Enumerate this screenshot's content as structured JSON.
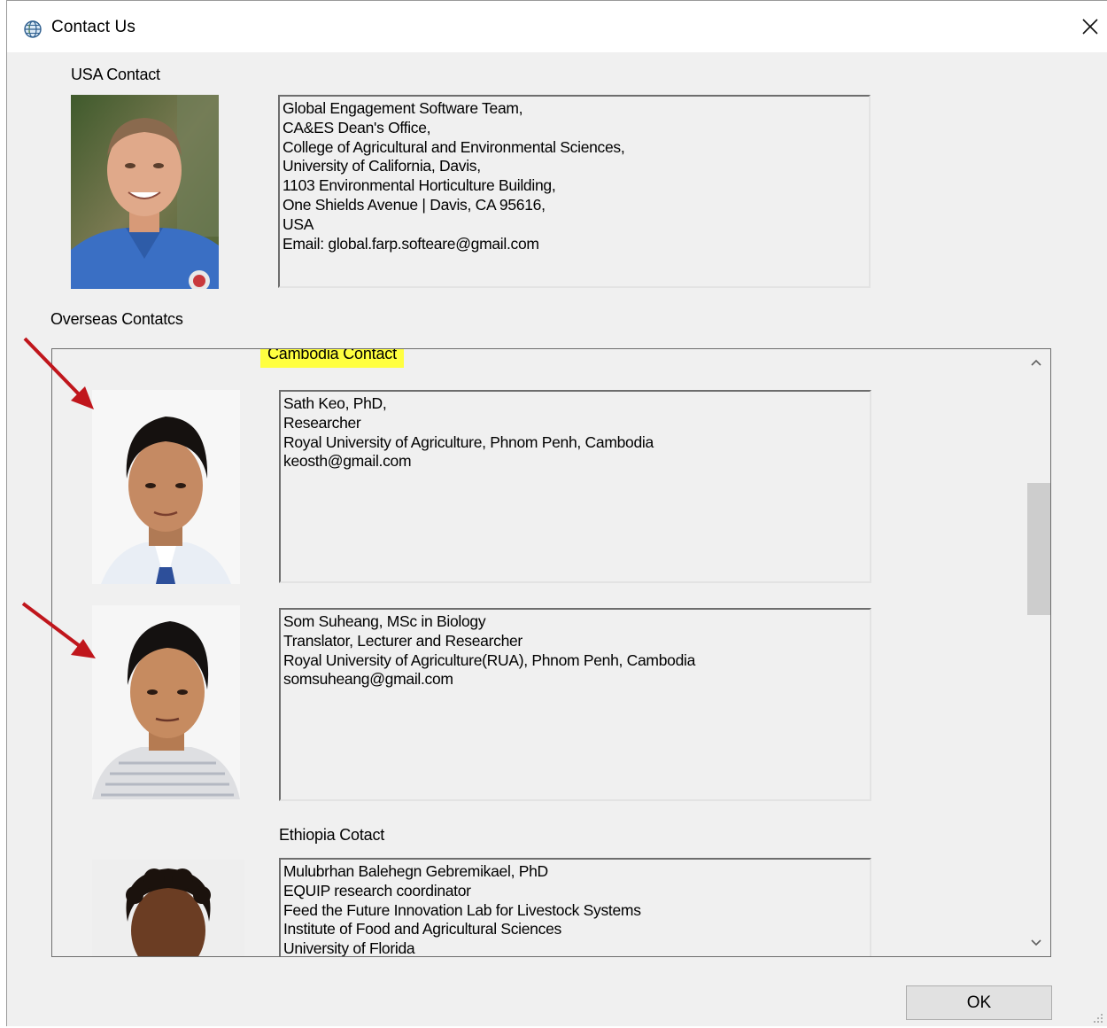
{
  "window": {
    "title": "Contact Us",
    "ok_label": "OK"
  },
  "usa": {
    "label": "USA Contact",
    "lines": [
      "Global Engagement Software Team,",
      "CA&ES Dean's Office,",
      "College of Agricultural and Environmental Sciences,",
      "University of California, Davis,",
      "1103 Environmental Horticulture Building,",
      "One Shields Avenue | Davis, CA 95616,",
      "USA",
      "Email: global.farp.softeare@gmail.com"
    ]
  },
  "overseas": {
    "label": "Overseas Contatcs",
    "cambodia_label": "Cambodia Contact",
    "ethiopia_label": "Ethiopia Cotact",
    "contacts": [
      {
        "lines": [
          "Sath Keo, PhD,",
          "Researcher",
          "Royal University of Agriculture, Phnom Penh, Cambodia",
          "keosth@gmail.com"
        ]
      },
      {
        "lines": [
          "Som Suheang, MSc in Biology",
          "Translator, Lecturer and Researcher",
          "Royal University of Agriculture(RUA), Phnom Penh, Cambodia",
          "somsuheang@gmail.com"
        ]
      },
      {
        "lines": [
          "Mulubrhan Balehegn Gebremikael, PhD",
          "EQUIP research coordinator",
          "Feed the Future Innovation Lab for Livestock Systems",
          "Institute of Food and Agricultural Sciences",
          "University of Florida"
        ]
      }
    ]
  },
  "colors": {
    "highlight": "#ffff40",
    "annotation_arrow": "#c0161c",
    "dialog_background": "#f0f0f0"
  },
  "icons": [
    "globe-icon",
    "close-icon",
    "chevron-up-icon",
    "chevron-down-icon"
  ]
}
